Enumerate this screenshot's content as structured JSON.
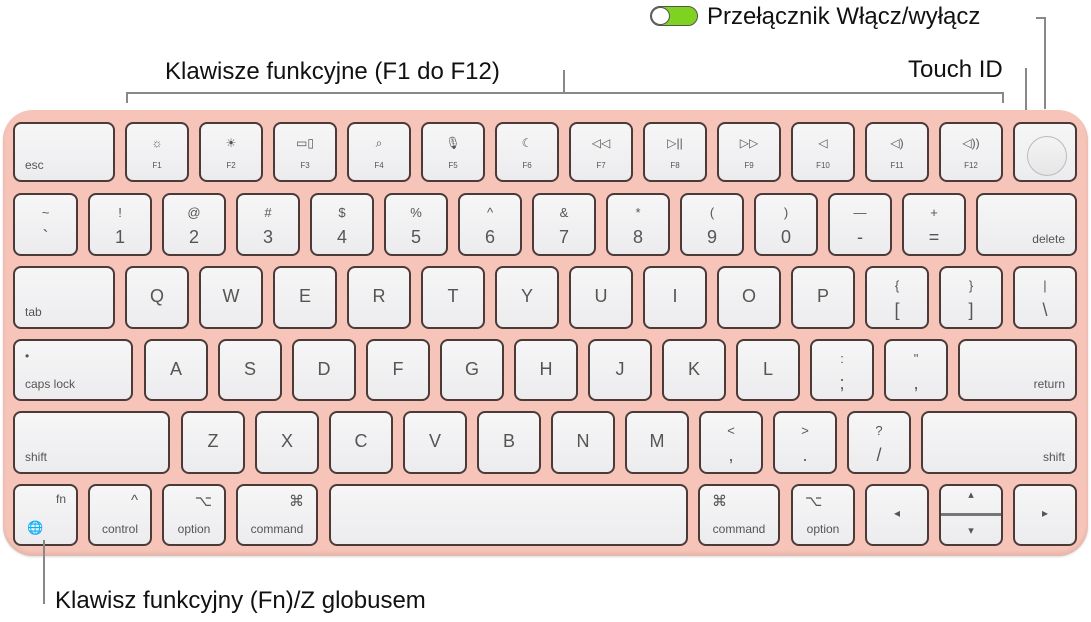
{
  "callouts": {
    "power_switch": "Przełącznik Włącz/wyłącz",
    "touch_id": "Touch ID",
    "function_keys": "Klawisze funkcyjne (F1 do F12)",
    "fn_globe": "Klawisz funkcyjny (Fn)/Z globusem"
  },
  "colors": {
    "keyboard_body": "#f6c4b8",
    "toggle_on": "#7ed321"
  },
  "rows": [
    [
      {
        "label": "esc"
      },
      {
        "fn": "F1",
        "icon": "☼"
      },
      {
        "fn": "F2",
        "icon": "☀"
      },
      {
        "fn": "F3",
        "icon": "▭▯"
      },
      {
        "fn": "F4",
        "icon": "⌕"
      },
      {
        "fn": "F5",
        "icon": "🎙"
      },
      {
        "fn": "F6",
        "icon": "☾"
      },
      {
        "fn": "F7",
        "icon": "◁◁"
      },
      {
        "fn": "F8",
        "icon": "▷||"
      },
      {
        "fn": "F9",
        "icon": "▷▷"
      },
      {
        "fn": "F10",
        "icon": "◁"
      },
      {
        "fn": "F11",
        "icon": "◁)"
      },
      {
        "fn": "F12",
        "icon": "◁))"
      },
      {
        "touchid": true
      }
    ],
    [
      {
        "top": "~",
        "bottom": "`"
      },
      {
        "top": "!",
        "bottom": "1"
      },
      {
        "top": "@",
        "bottom": "2"
      },
      {
        "top": "#",
        "bottom": "3"
      },
      {
        "top": "$",
        "bottom": "4"
      },
      {
        "top": "%",
        "bottom": "5"
      },
      {
        "top": "^",
        "bottom": "6"
      },
      {
        "top": "&",
        "bottom": "7"
      },
      {
        "top": "*",
        "bottom": "8"
      },
      {
        "top": "(",
        "bottom": "9"
      },
      {
        "top": ")",
        "bottom": "0"
      },
      {
        "top": "—",
        "bottom": "-"
      },
      {
        "top": "+",
        "bottom": "="
      },
      {
        "labelr": "delete"
      }
    ],
    [
      {
        "label": "tab"
      },
      {
        "main": "Q"
      },
      {
        "main": "W"
      },
      {
        "main": "E"
      },
      {
        "main": "R"
      },
      {
        "main": "T"
      },
      {
        "main": "Y"
      },
      {
        "main": "U"
      },
      {
        "main": "I"
      },
      {
        "main": "O"
      },
      {
        "main": "P"
      },
      {
        "top": "{",
        "bottom": "["
      },
      {
        "top": "}",
        "bottom": "]"
      },
      {
        "top": "|",
        "bottom": "\\"
      }
    ],
    [
      {
        "label": "caps lock",
        "dot": "•"
      },
      {
        "main": "A"
      },
      {
        "main": "S"
      },
      {
        "main": "D"
      },
      {
        "main": "F"
      },
      {
        "main": "G"
      },
      {
        "main": "H"
      },
      {
        "main": "J"
      },
      {
        "main": "K"
      },
      {
        "main": "L"
      },
      {
        "top": ":",
        "bottom": ";"
      },
      {
        "top": "\"",
        "bottom": ","
      },
      {
        "labelr": "return"
      }
    ],
    [
      {
        "label": "shift"
      },
      {
        "main": "Z"
      },
      {
        "main": "X"
      },
      {
        "main": "C"
      },
      {
        "main": "V"
      },
      {
        "main": "B"
      },
      {
        "main": "N"
      },
      {
        "main": "M"
      },
      {
        "top": "<",
        "bottom": ","
      },
      {
        "top": ">",
        "bottom": "."
      },
      {
        "top": "?",
        "bottom": "/"
      },
      {
        "labelr": "shift"
      }
    ],
    [
      {
        "fnkey": "fn",
        "globe": "🌐"
      },
      {
        "labelc": "control",
        "glyph": "^"
      },
      {
        "labelc": "option",
        "glyph": "⌥"
      },
      {
        "labelc": "command",
        "glyph": "⌘"
      },
      {
        "space": true
      },
      {
        "labelc": "command",
        "glyphl": "⌘"
      },
      {
        "labelc": "option",
        "glyphl": "⌥"
      },
      {
        "arrow": "◂"
      },
      {
        "arrows": [
          "▴",
          "▾"
        ]
      },
      {
        "arrow": "▸"
      }
    ]
  ]
}
